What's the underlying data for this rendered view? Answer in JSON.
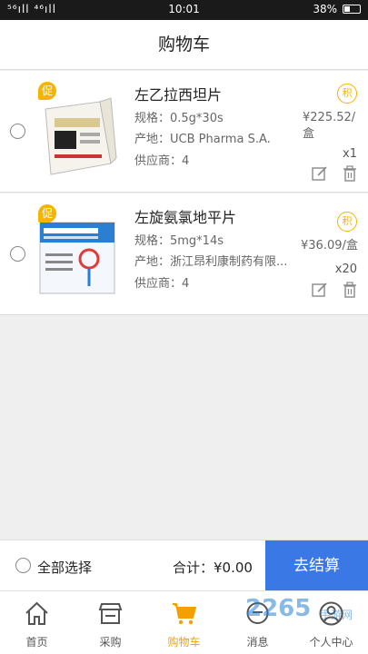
{
  "status_bar": {
    "left": "⁵⁶ıll ⁴⁶ıll",
    "time": "10:01",
    "battery": "38%"
  },
  "header": {
    "title": "购物车"
  },
  "cart_items": [
    {
      "promo": "促",
      "name": "左乙拉西坦片",
      "spec": "规格：0.5g*30s",
      "origin": "产地：UCB Pharma S.A.",
      "supplier": "供应商：4",
      "points": "积",
      "price": "¥225.52/盒",
      "qty": "x1"
    },
    {
      "promo": "促",
      "name": "左旋氨氯地平片",
      "spec": "规格：5mg*14s",
      "origin": "产地：浙江昂利康制药有限...",
      "supplier": "供应商：4",
      "points": "积",
      "price": "¥36.09/盒",
      "qty": "x20"
    }
  ],
  "footer": {
    "select_all": "全部选择",
    "total": "合计：¥0.00",
    "checkout": "去结算"
  },
  "tabs": [
    {
      "label": "首页",
      "icon": "home-icon"
    },
    {
      "label": "采购",
      "icon": "store-icon"
    },
    {
      "label": "购物车",
      "icon": "cart-icon",
      "active": true
    },
    {
      "label": "消息",
      "icon": "message-icon"
    },
    {
      "label": "个人中心",
      "icon": "user-icon"
    }
  ],
  "watermark": {
    "main": "2265",
    "sub": "手游网"
  },
  "colors": {
    "accent": "#f4b400",
    "checkout": "#3a78e6"
  }
}
